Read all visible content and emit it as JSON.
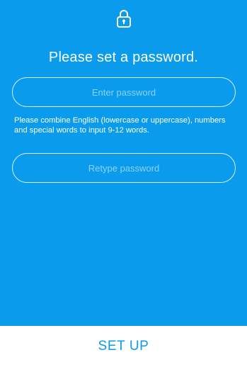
{
  "header": {
    "icon": "lock-icon",
    "title": "Please set a password."
  },
  "form": {
    "password_placeholder": "Enter password",
    "hint": "Please combine English (lowercase or uppercase), numbers and special words to input 9-12 words.",
    "retype_placeholder": "Retype password"
  },
  "footer": {
    "setup_label": "SET UP"
  },
  "colors": {
    "background": "#0a9bec",
    "footer_background": "#ffffff",
    "button_text": "#0a9bec"
  }
}
